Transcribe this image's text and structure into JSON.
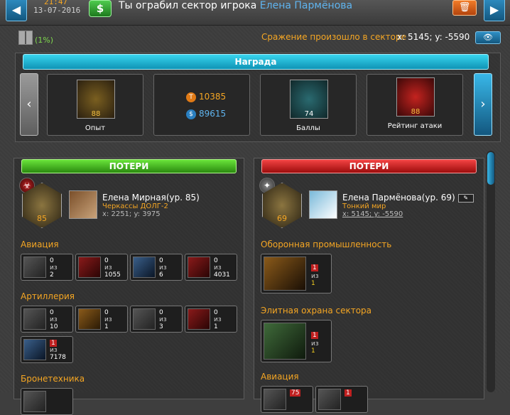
{
  "header": {
    "time": "21:47",
    "date": "13-07-2016",
    "message_prefix": "Ты ограбил сектор игрока",
    "message_player": "Елена Пармёнова",
    "percent": "(1%)",
    "battle_text": "Сражение произошло в секторе",
    "battle_coords": "x: 5145; y: -5590"
  },
  "reward": {
    "title": "Награда",
    "experience": {
      "label": "Опыт",
      "value": "88"
    },
    "resources": {
      "titanium": "10385",
      "money": "89615"
    },
    "points": {
      "label": "Баллы",
      "value": "74"
    },
    "attack_rating": {
      "label": "Рейтинг атаки",
      "value": "88"
    }
  },
  "left": {
    "header": "ПОТЕРИ",
    "level_badge": "85",
    "name": "Елена Мирная(ур. 85)",
    "alliance": "Черкассы ДОЛГ-2",
    "coords": "x: 2251; y: 3975",
    "sections": [
      {
        "title": "Авиация",
        "units": [
          {
            "lost": "0",
            "of": "из",
            "total": "2"
          },
          {
            "lost": "0",
            "of": "из",
            "total": "1055"
          },
          {
            "lost": "0",
            "of": "из",
            "total": "6"
          },
          {
            "lost": "0",
            "of": "из",
            "total": "4031"
          }
        ]
      },
      {
        "title": "Артиллерия",
        "units": [
          {
            "lost": "0",
            "of": "из",
            "total": "10"
          },
          {
            "lost": "0",
            "of": "из",
            "total": "1"
          },
          {
            "lost": "0",
            "of": "из",
            "total": "3"
          },
          {
            "lost": "0",
            "of": "из",
            "total": "1"
          },
          {
            "lost": "1",
            "of": "из",
            "total": "7178"
          }
        ]
      },
      {
        "title": "Бронетехника",
        "units": []
      }
    ]
  },
  "right": {
    "header": "ПОТЕРИ",
    "level_badge": "69",
    "name": "Елена Пармёнова(ур. 69)",
    "alliance": "Тонкий мир",
    "coords": "x: 5145; y: -5590",
    "sections": [
      {
        "title": "Оборонная промышленность",
        "units": [
          {
            "lost": "1",
            "of": "из",
            "total": "1"
          }
        ]
      },
      {
        "title": "Элитная охрана сектора",
        "units": [
          {
            "lost": "1",
            "of": "из",
            "total": "1"
          }
        ]
      },
      {
        "title": "Авиация",
        "units": [
          {
            "lost": "75",
            "of": "",
            "total": ""
          },
          {
            "lost": "1",
            "of": "",
            "total": ""
          }
        ]
      }
    ]
  }
}
